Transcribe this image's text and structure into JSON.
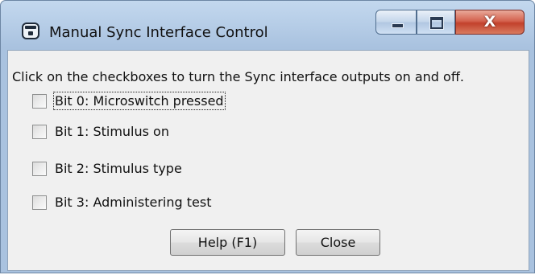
{
  "window": {
    "title": "Manual Sync Interface Control",
    "icons": {
      "app": "app-window-icon",
      "minimize": "minimize-icon",
      "maximize": "maximize-icon",
      "close": "close-icon"
    },
    "close_glyph": "X"
  },
  "content": {
    "instruction": "Click on the checkboxes to turn the Sync interface outputs on and off.",
    "checkboxes": [
      {
        "label": "Bit 0: Microswitch pressed",
        "checked": false,
        "focused": true
      },
      {
        "label": "Bit 1: Stimulus on",
        "checked": false,
        "focused": false
      },
      {
        "label": "Bit 2: Stimulus type",
        "checked": false,
        "focused": false
      },
      {
        "label": "Bit 3: Administering test",
        "checked": false,
        "focused": false
      }
    ],
    "buttons": {
      "help": "Help (F1)",
      "close": "Close"
    }
  },
  "colors": {
    "titlebar": "#b6cde7",
    "close_button": "#c2412c",
    "dialog_body": "#f0f0f0"
  }
}
